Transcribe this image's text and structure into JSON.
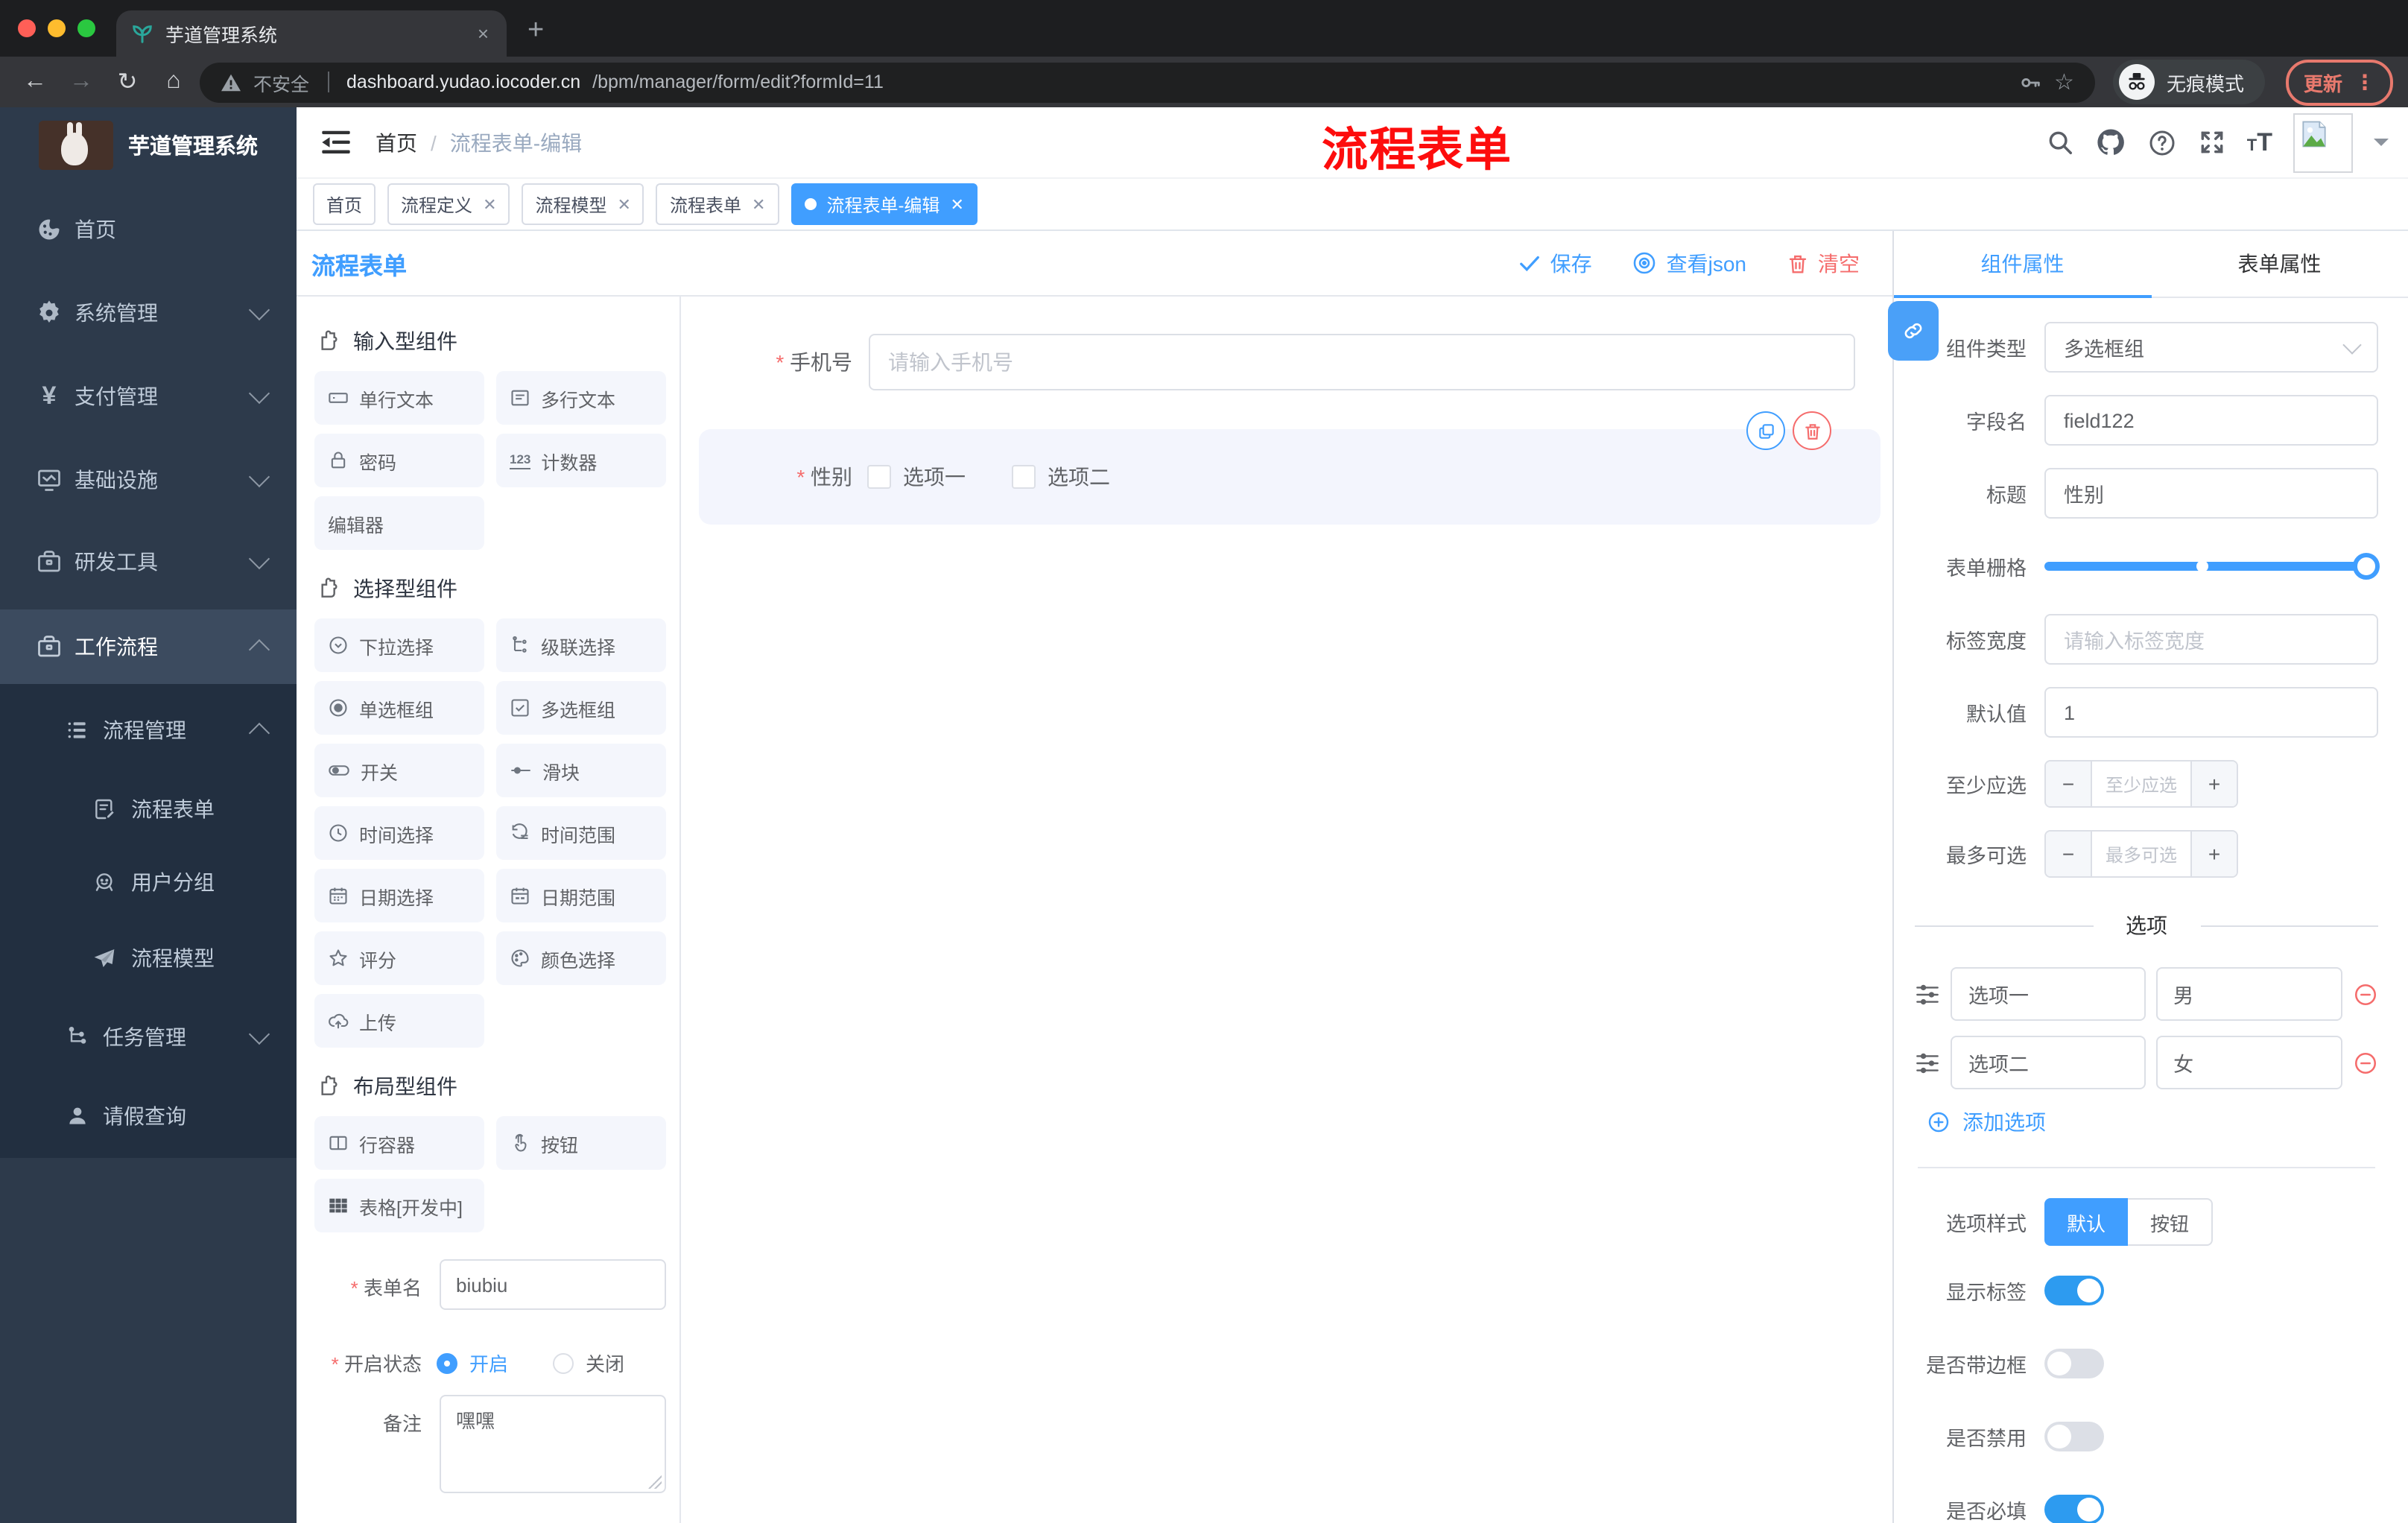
{
  "browser": {
    "tab_title": "芋道管理系统",
    "new_tab": "+",
    "close": "×",
    "back": "←",
    "forward": "→",
    "reload": "↻",
    "home": "⌂",
    "security_label": "不安全",
    "url_domain": "dashboard.yudao.iocoder.cn",
    "url_path": "/bpm/manager/form/edit?formId=11",
    "star": "☆",
    "incognito_label": "无痕模式",
    "update_label": "更新",
    "menu_dots": "⋮"
  },
  "sidebar": {
    "app_title": "芋道管理系统",
    "items": [
      {
        "label": "首页"
      },
      {
        "label": "系统管理"
      },
      {
        "label": "支付管理"
      },
      {
        "label": "基础设施"
      },
      {
        "label": "研发工具"
      },
      {
        "label": "工作流程"
      },
      {
        "label": "流程管理"
      },
      {
        "label": "流程表单"
      },
      {
        "label": "用户分组"
      },
      {
        "label": "流程模型"
      },
      {
        "label": "任务管理"
      },
      {
        "label": "请假查询"
      }
    ]
  },
  "header": {
    "breadcrumb_home": "首页",
    "breadcrumb_sep": "/",
    "breadcrumb_current": "流程表单-编辑",
    "annotation": "流程表单"
  },
  "tabbar": {
    "tabs": [
      {
        "label": "首页"
      },
      {
        "label": "流程定义"
      },
      {
        "label": "流程模型"
      },
      {
        "label": "流程表单"
      },
      {
        "label": "流程表单-编辑"
      }
    ]
  },
  "designer": {
    "panel_title": "流程表单",
    "toolbar": {
      "save": "保存",
      "view_json": "查看json",
      "clear": "清空"
    },
    "palette": [
      {
        "title": "输入型组件",
        "items": [
          "单行文本",
          "多行文本",
          "密码",
          "计数器",
          "编辑器"
        ]
      },
      {
        "title": "选择型组件",
        "items": [
          "下拉选择",
          "级联选择",
          "单选框组",
          "多选框组",
          "开关",
          "滑块",
          "时间选择",
          "时间范围",
          "日期选择",
          "日期范围",
          "评分",
          "颜色选择",
          "上传"
        ]
      },
      {
        "title": "布局型组件",
        "items": [
          "行容器",
          "按钮",
          "表格[开发中]"
        ]
      }
    ],
    "meta": {
      "form_name_label": "表单名",
      "form_name_value": "biubiu",
      "status_label": "开启状态",
      "status_on": "开启",
      "status_off": "关闭",
      "remark_label": "备注",
      "remark_value": "嘿嘿"
    }
  },
  "canvas": {
    "phone_label": "手机号",
    "phone_placeholder": "请输入手机号",
    "gender_label": "性别",
    "gender_options": [
      "选项一",
      "选项二"
    ]
  },
  "props": {
    "tab_component": "组件属性",
    "tab_form": "表单属性",
    "rows": {
      "type_label": "组件类型",
      "type_value": "多选框组",
      "field_label": "字段名",
      "field_value": "field122",
      "title_label": "标题",
      "title_value": "性别",
      "grid_label": "表单栅格",
      "width_label": "标签宽度",
      "width_placeholder": "请输入标签宽度",
      "default_label": "默认值",
      "default_value": "1",
      "min_label": "至少应选",
      "min_placeholder": "至少应选",
      "max_label": "最多可选",
      "max_placeholder": "最多可选"
    },
    "options": {
      "divider": "选项",
      "rows": [
        {
          "label": "选项一",
          "value": "男"
        },
        {
          "label": "选项二",
          "value": "女"
        }
      ],
      "add": "添加选项"
    },
    "style": {
      "label": "选项样式",
      "seg_default": "默认",
      "seg_button": "按钮",
      "show_label": "显示标签",
      "border_label": "是否带边框",
      "disabled_label": "是否禁用",
      "required_label": "是否必填"
    }
  },
  "colors": {
    "accent": "#409eff",
    "danger": "#f56c6c"
  }
}
